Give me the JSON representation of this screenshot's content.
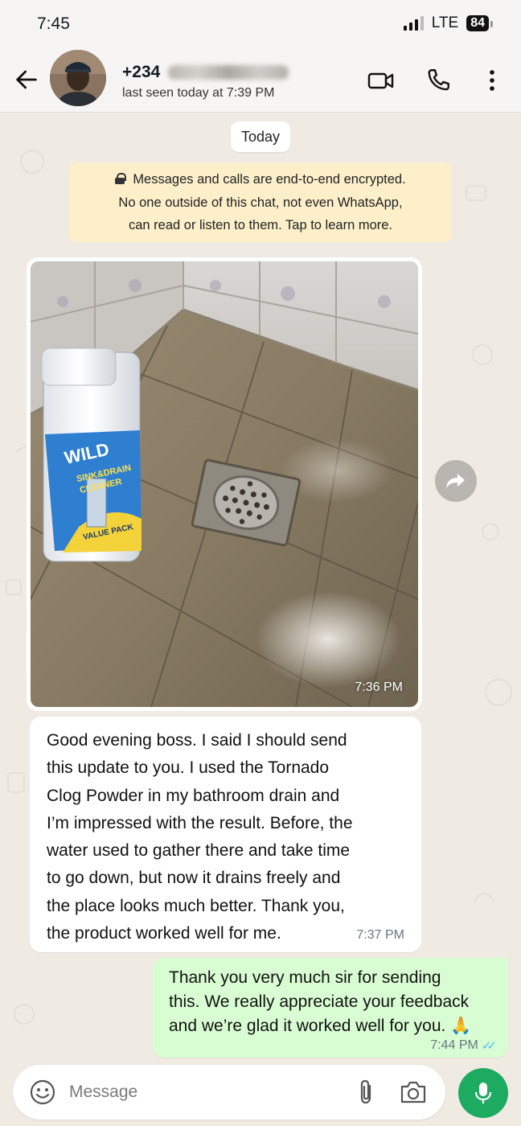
{
  "status_bar": {
    "time": "7:45",
    "network": "LTE",
    "battery": "84"
  },
  "header": {
    "back_icon": "arrow-left-icon",
    "contact_prefix": "+234",
    "last_seen": "last seen today at 7:39 PM",
    "video_call_icon": "video-camera-icon",
    "voice_call_icon": "phone-icon",
    "menu_icon": "more-vertical-icon"
  },
  "chat": {
    "date_chip": "Today",
    "encryption_notice": {
      "line1": "Messages and calls are end-to-end encrypted.",
      "line2": "No one outside of this chat, not even WhatsApp,",
      "line3": "can read or listen to them. Tap to learn more."
    },
    "image_message": {
      "time": "7:36 PM",
      "bottle_label_1": "WILD",
      "bottle_label_2": "SINK&DRAIN",
      "bottle_label_3": "CLEANER",
      "bottle_label_4": "VALUE PACK"
    },
    "incoming_message": {
      "lines": [
        "Good evening boss. I said I should send",
        "this update to you. I used the Tornado",
        "Clog Powder in my bathroom drain and",
        "I’m impressed with the result. Before, the",
        "water used to gather there and take time",
        "to go down, but now it drains freely and",
        "the place looks much better. Thank you,",
        "the product worked well for me."
      ],
      "time": "7:37 PM"
    },
    "outgoing_message": {
      "lines": [
        "Thank you very much sir for sending",
        "this. We really appreciate your feedback",
        "and we’re glad it worked well for you. 🙏"
      ],
      "time": "7:44 PM",
      "status": "read"
    }
  },
  "composer": {
    "placeholder": "Message",
    "emoji_icon": "emoji-icon",
    "attach_icon": "paperclip-icon",
    "camera_icon": "camera-icon",
    "mic_icon": "microphone-icon"
  },
  "colors": {
    "chat_background": "#efeae2",
    "outgoing_bubble": "#d9fdd3",
    "incoming_bubble": "#ffffff",
    "notice_background": "#fcefc9",
    "accent_green": "#1daa61",
    "read_ticks": "#53bdeb"
  }
}
